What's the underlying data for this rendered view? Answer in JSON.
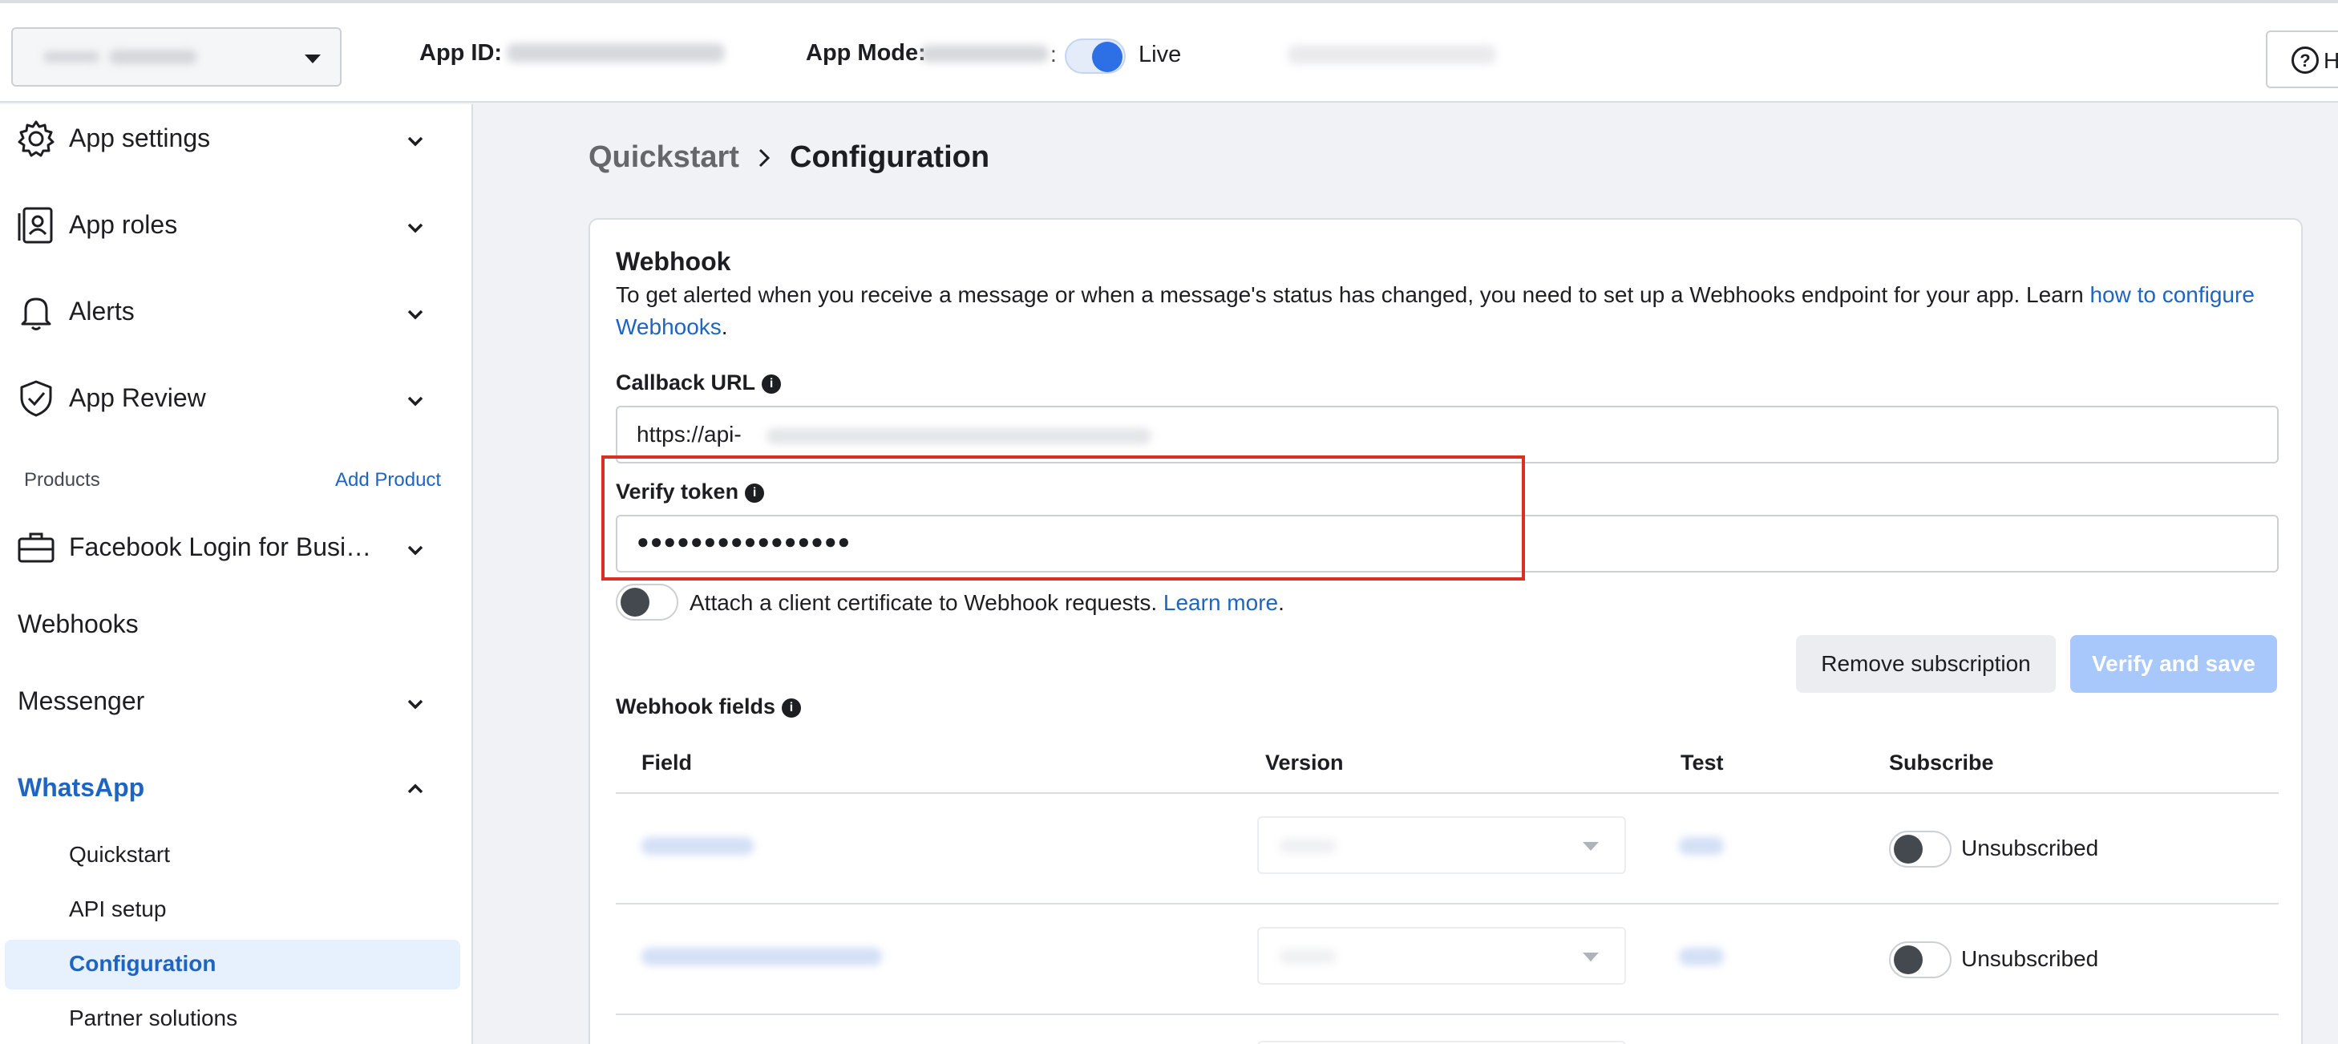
{
  "topbar": {
    "app_id_label": "App ID:",
    "app_mode_label": "App Mode:",
    "app_mode_colon": ":",
    "mode_value": "Live",
    "help_label": "H"
  },
  "sidebar": {
    "items": [
      {
        "label": "App settings"
      },
      {
        "label": "App roles"
      },
      {
        "label": "Alerts"
      },
      {
        "label": "App Review"
      }
    ],
    "products_label": "Products",
    "add_product": "Add Product",
    "product_items": [
      {
        "label": "Facebook Login for Busi…"
      },
      {
        "label": "Webhooks"
      },
      {
        "label": "Messenger"
      },
      {
        "label": "WhatsApp"
      }
    ],
    "whatsapp_sub": [
      {
        "label": "Quickstart"
      },
      {
        "label": "API setup"
      },
      {
        "label": "Configuration"
      },
      {
        "label": "Partner solutions"
      }
    ]
  },
  "breadcrumb": {
    "parent": "Quickstart",
    "current": "Configuration"
  },
  "webhook": {
    "title": "Webhook",
    "desc_prefix": "To get alerted when you receive a message or when a message's status has changed, you need to set up a Webhooks endpoint for your app. Learn ",
    "desc_link": "how to configure Webhooks",
    "desc_suffix": ".",
    "callback_label": "Callback URL",
    "callback_value": "https://api-",
    "verify_label": "Verify token",
    "verify_value": "●●●●●●●●●●●●●●●●",
    "attach_text": "Attach a client certificate to Webhook requests. ",
    "learn_more": "Learn more",
    "attach_suffix": ".",
    "remove_button": "Remove subscription",
    "verify_button": "Verify and save",
    "fields_label": "Webhook fields"
  },
  "table": {
    "headers": [
      "Field",
      "Version",
      "Test",
      "Subscribe"
    ],
    "rows": [
      {
        "status": "Unsubscribed"
      },
      {
        "status": "Unsubscribed"
      }
    ]
  },
  "colors": {
    "accent": "#1d65c1",
    "toggle_on": "#2d6fe5",
    "highlight": "#d93025"
  }
}
